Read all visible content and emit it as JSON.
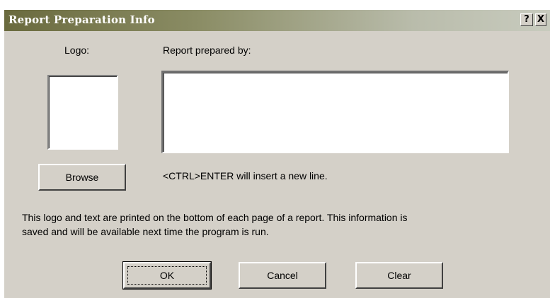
{
  "window": {
    "title": "Report Preparation Info",
    "help_glyph": "?",
    "close_glyph": "X"
  },
  "logo": {
    "label": "Logo:",
    "browse_label": "Browse"
  },
  "prepared_by": {
    "label": "Report prepared by:",
    "value": "",
    "hint": "<CTRL>ENTER will insert a new line."
  },
  "info": {
    "line1": "This logo and text are printed on the bottom of each page of a report.  This information is",
    "line2": "saved and will be available next time the program is run."
  },
  "buttons": {
    "ok": "OK",
    "cancel": "Cancel",
    "clear": "Clear"
  }
}
